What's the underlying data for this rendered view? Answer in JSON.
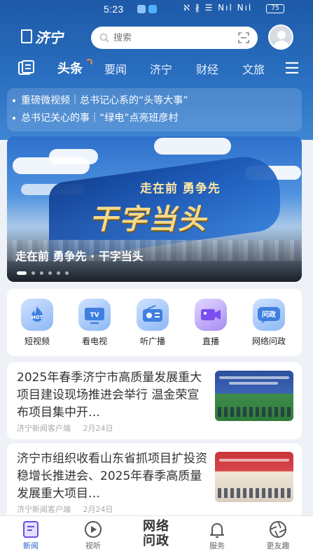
{
  "status_bar": {
    "time": "5:23",
    "icons_text": "ℵ ∦ ☰ Nıl Nıl",
    "battery": "75"
  },
  "header": {
    "logo_text": "济宁",
    "search_placeholder": "搜索",
    "search_icon": "search-icon",
    "scan_icon": "scan-icon",
    "avatar_icon": "user-avatar-icon"
  },
  "tabs": {
    "items": [
      "头条",
      "要闻",
      "济宁",
      "财经",
      "文旅"
    ],
    "active_index": 0,
    "left_icon": "channel-library-icon",
    "menu_icon": "menu-icon"
  },
  "ticker": {
    "items": [
      "重磅微视频｜总书记心系的“头等大事”",
      "总书记关心的事｜“绿电”点亮班彦村"
    ]
  },
  "banner": {
    "slogan_small": "走在前 勇争先",
    "slogan_big": "干字当头",
    "caption": "走在前 勇争先 · 干字当头",
    "dot_count": 6,
    "active_dot": 0
  },
  "quick_entries": [
    {
      "label": "短视频",
      "icon": "hot-flame-icon",
      "badge": "HOT"
    },
    {
      "label": "看电视",
      "icon": "tv-icon",
      "badge": "TV"
    },
    {
      "label": "听广播",
      "icon": "radio-icon",
      "badge": ""
    },
    {
      "label": "直播",
      "icon": "live-camera-icon",
      "badge": ""
    },
    {
      "label": "网络问政",
      "icon": "wenzheng-icon",
      "badge": "问政"
    }
  ],
  "news": [
    {
      "title": "2025年春季济宁市高质量发展重大项目建设现场推进会举行 温金荣宣布项目集中开…",
      "source": "济宁新闻客户端",
      "date": "2月24日",
      "thumb": "meeting-stage-photo"
    },
    {
      "title": "济宁市组织收看山东省抓项目扩投资稳增长推进会、2025年春季高质量发展重大项目…",
      "source": "济宁新闻客户端",
      "date": "2月24日",
      "thumb": "conference-hall-photo"
    }
  ],
  "bottom_nav": {
    "items": [
      {
        "label": "新闻",
        "icon": "news-icon"
      },
      {
        "label": "视听",
        "icon": "play-icon"
      },
      {
        "label": "服务",
        "icon": "bell-icon"
      },
      {
        "label": "更友趣",
        "icon": "aperture-icon"
      }
    ],
    "center_line1": "网络",
    "center_line2": "问政",
    "active_index": 0
  },
  "colors": {
    "brand_blue": "#1d5aa8",
    "active_nav": "#2e63c5",
    "slogan_gold": "#f6d98a"
  }
}
